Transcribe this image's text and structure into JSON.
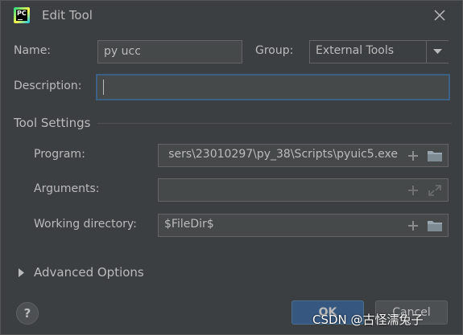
{
  "window": {
    "title": "Edit Tool",
    "app_icon_text": "PC"
  },
  "name": {
    "label": "Name:",
    "value": "py ucc"
  },
  "group": {
    "label": "Group:",
    "value": "External Tools"
  },
  "description": {
    "label": "Description:",
    "value": ""
  },
  "tool_settings": {
    "heading": "Tool Settings",
    "program": {
      "label": "Program:",
      "value": "sers\\23010297\\py_38\\Scripts\\pyuic5.exe"
    },
    "arguments": {
      "label": "Arguments:",
      "value": ""
    },
    "working_directory": {
      "label": "Working directory:",
      "value": "$FileDir$"
    }
  },
  "advanced": {
    "label": "Advanced Options"
  },
  "buttons": {
    "help": "?",
    "ok": "OK",
    "cancel": "Cancel"
  },
  "watermark": "CSDN @古怪濡兔子",
  "colors": {
    "background": "#3c3f41",
    "field": "#45494a",
    "accent": "#365880",
    "focus": "#3d6185"
  }
}
